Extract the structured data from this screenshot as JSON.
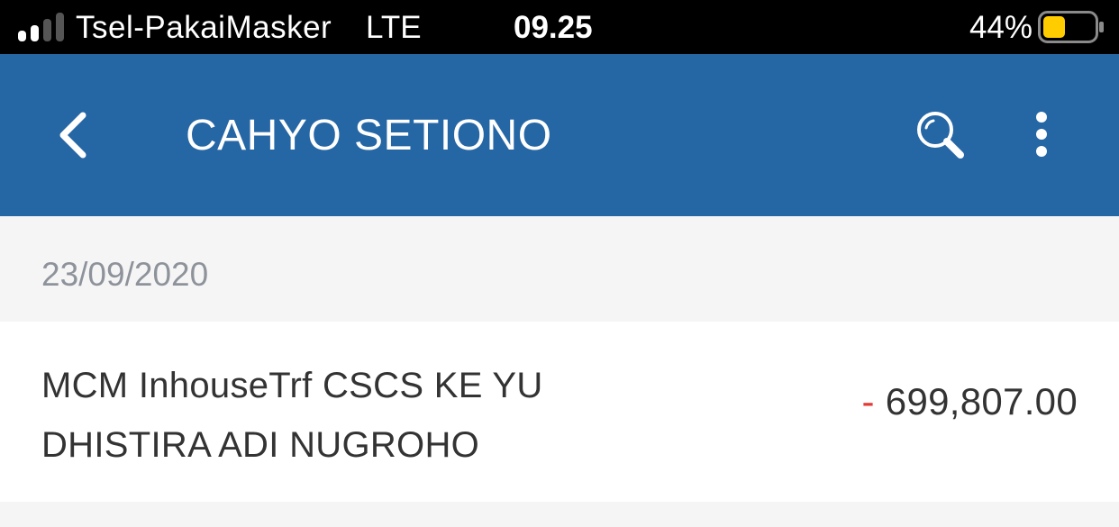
{
  "status_bar": {
    "carrier": "Tsel-PakaiMasker",
    "network": "LTE",
    "time": "09.25",
    "battery_percent": "44%",
    "battery_level": 0.44,
    "signal_bars_active": 2,
    "signal_bars_total": 4
  },
  "header": {
    "title": "CAHYO SETIONO",
    "back_icon": "chevron-left-icon",
    "search_icon": "search-icon",
    "more_icon": "more-vertical-icon"
  },
  "transactions": {
    "date": "23/09/2020",
    "items": [
      {
        "description": "MCM InhouseTrf CSCS KE YU DHISTIRA ADI NUGROHO",
        "sign": "-",
        "amount": "699,807.00"
      }
    ]
  },
  "colors": {
    "app_bar": "#2566a5",
    "debit_sign": "#e53935",
    "date_text": "#8e939b",
    "battery_fill": "#ffcc00"
  }
}
